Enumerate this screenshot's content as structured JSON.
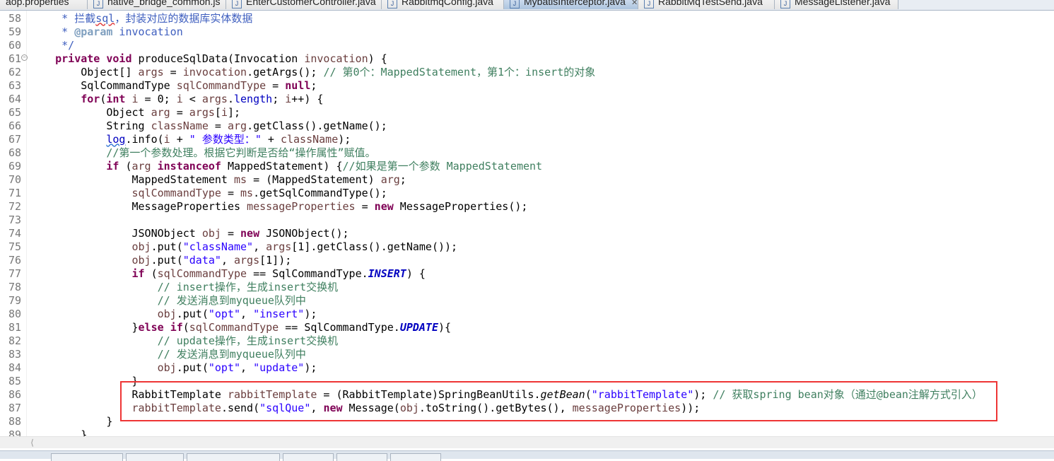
{
  "tabs": [
    {
      "label": "aop.properties",
      "icon": "properties-file-icon",
      "active": false
    },
    {
      "label": "native_bridge_common.js",
      "icon": "js-file-icon",
      "active": false
    },
    {
      "label": "EnterCustomerController.java",
      "icon": "java-file-icon",
      "active": false
    },
    {
      "label": "RabbitmqConfig.java",
      "icon": "java-warning-file-icon",
      "active": false
    },
    {
      "label": "MybatisInterceptor.java",
      "icon": "java-file-icon",
      "active": true
    },
    {
      "label": "RabbitMqTestSend.java",
      "icon": "java-file-icon",
      "active": false
    },
    {
      "label": "MessageListener.java",
      "icon": "java-warning-file-icon",
      "active": false
    }
  ],
  "colors": {
    "keyword": "#7F0055",
    "string": "#2A00FF",
    "comment": "#3F7F5F",
    "javadoc": "#3F5FBF",
    "field": "#0000C0",
    "local": "#6A3E3E",
    "highlight_box": "#EE3535"
  },
  "editor": {
    "lines": [
      {
        "n": "58",
        "t": [
          [
            "j",
            "     * 拦截"
          ],
          [
            "j sp",
            "sql"
          ],
          [
            "j",
            "，封装对应的数据库实体数据"
          ]
        ]
      },
      {
        "n": "59",
        "t": [
          [
            "j",
            "     * "
          ],
          [
            "jt",
            "@param"
          ],
          [
            "j",
            " invocation"
          ]
        ]
      },
      {
        "n": "60",
        "t": [
          [
            "j",
            "     */"
          ]
        ]
      },
      {
        "n": "61",
        "fold": true,
        "t": [
          [
            "p",
            "    "
          ],
          [
            "k",
            "private"
          ],
          [
            "p",
            " "
          ],
          [
            "k",
            "void"
          ],
          [
            "p",
            " produceSqlData(Invocation "
          ],
          [
            "v",
            "invocation"
          ],
          [
            "p",
            ") {"
          ]
        ]
      },
      {
        "n": "62",
        "t": [
          [
            "p",
            "        Object[] "
          ],
          [
            "v",
            "args"
          ],
          [
            "p",
            " = "
          ],
          [
            "v",
            "invocation"
          ],
          [
            "p",
            ".getArgs(); "
          ],
          [
            "c",
            "// 第0个：MappedStatement，第1个：insert的对象"
          ]
        ]
      },
      {
        "n": "63",
        "t": [
          [
            "p",
            "        SqlCommandType "
          ],
          [
            "v",
            "sqlCommandType"
          ],
          [
            "p",
            " = "
          ],
          [
            "k",
            "null"
          ],
          [
            "p",
            ";"
          ]
        ]
      },
      {
        "n": "64",
        "t": [
          [
            "p",
            "        "
          ],
          [
            "k",
            "for"
          ],
          [
            "p",
            "("
          ],
          [
            "k",
            "int"
          ],
          [
            "p",
            " "
          ],
          [
            "v",
            "i"
          ],
          [
            "p",
            " = 0; "
          ],
          [
            "v",
            "i"
          ],
          [
            "p",
            " < "
          ],
          [
            "v",
            "args"
          ],
          [
            "p",
            "."
          ],
          [
            "f",
            "length"
          ],
          [
            "p",
            "; "
          ],
          [
            "v",
            "i"
          ],
          [
            "p",
            "++) {"
          ]
        ]
      },
      {
        "n": "65",
        "t": [
          [
            "p",
            "            Object "
          ],
          [
            "v",
            "arg"
          ],
          [
            "p",
            " = "
          ],
          [
            "v",
            "args"
          ],
          [
            "p",
            "["
          ],
          [
            "v",
            "i"
          ],
          [
            "p",
            "];"
          ]
        ]
      },
      {
        "n": "66",
        "t": [
          [
            "p",
            "            String "
          ],
          [
            "v",
            "className"
          ],
          [
            "p",
            " = "
          ],
          [
            "v",
            "arg"
          ],
          [
            "p",
            ".getClass().getName();"
          ]
        ]
      },
      {
        "n": "67",
        "t": [
          [
            "p",
            "            "
          ],
          [
            "u",
            "log"
          ],
          [
            "p",
            ".info("
          ],
          [
            "v",
            "i"
          ],
          [
            "p",
            " + "
          ],
          [
            "s",
            "\" 参数类型：\""
          ],
          [
            "p",
            " + "
          ],
          [
            "v",
            "className"
          ],
          [
            "p",
            ");"
          ]
        ]
      },
      {
        "n": "68",
        "t": [
          [
            "p",
            "            "
          ],
          [
            "c",
            "//第一个参数处理。根据它判断是否给“操作属性”赋值。"
          ]
        ]
      },
      {
        "n": "69",
        "t": [
          [
            "p",
            "            "
          ],
          [
            "k",
            "if"
          ],
          [
            "p",
            " ("
          ],
          [
            "v",
            "arg"
          ],
          [
            "p",
            " "
          ],
          [
            "k",
            "instanceof"
          ],
          [
            "p",
            " MappedStatement) {"
          ],
          [
            "c",
            "//如果是第一个参数 MappedStatement"
          ]
        ]
      },
      {
        "n": "70",
        "t": [
          [
            "p",
            "                MappedStatement "
          ],
          [
            "v",
            "ms"
          ],
          [
            "p",
            " = (MappedStatement) "
          ],
          [
            "v",
            "arg"
          ],
          [
            "p",
            ";"
          ]
        ]
      },
      {
        "n": "71",
        "t": [
          [
            "p",
            "                "
          ],
          [
            "v",
            "sqlCommandType"
          ],
          [
            "p",
            " = "
          ],
          [
            "v",
            "ms"
          ],
          [
            "p",
            ".getSqlCommandType();"
          ]
        ]
      },
      {
        "n": "72",
        "t": [
          [
            "p",
            "                MessageProperties "
          ],
          [
            "v",
            "messageProperties"
          ],
          [
            "p",
            " = "
          ],
          [
            "k",
            "new"
          ],
          [
            "p",
            " MessageProperties();"
          ]
        ]
      },
      {
        "n": "73",
        "t": []
      },
      {
        "n": "74",
        "t": [
          [
            "p",
            "                JSONObject "
          ],
          [
            "v",
            "obj"
          ],
          [
            "p",
            " = "
          ],
          [
            "k",
            "new"
          ],
          [
            "p",
            " JSONObject();"
          ]
        ]
      },
      {
        "n": "75",
        "t": [
          [
            "p",
            "                "
          ],
          [
            "v",
            "obj"
          ],
          [
            "p",
            ".put("
          ],
          [
            "s",
            "\"className\""
          ],
          [
            "p",
            ", "
          ],
          [
            "v",
            "args"
          ],
          [
            "p",
            "[1].getClass().getName());"
          ]
        ]
      },
      {
        "n": "76",
        "t": [
          [
            "p",
            "                "
          ],
          [
            "v",
            "obj"
          ],
          [
            "p",
            ".put("
          ],
          [
            "s",
            "\"data\""
          ],
          [
            "p",
            ", "
          ],
          [
            "v",
            "args"
          ],
          [
            "p",
            "[1]);"
          ]
        ]
      },
      {
        "n": "77",
        "t": [
          [
            "p",
            "                "
          ],
          [
            "k",
            "if"
          ],
          [
            "p",
            " ("
          ],
          [
            "v",
            "sqlCommandType"
          ],
          [
            "p",
            " == SqlCommandType."
          ],
          [
            "fi",
            "INSERT"
          ],
          [
            "p",
            ") {"
          ]
        ]
      },
      {
        "n": "78",
        "t": [
          [
            "p",
            "                    "
          ],
          [
            "c",
            "// insert操作，生成insert交换机"
          ]
        ]
      },
      {
        "n": "79",
        "t": [
          [
            "p",
            "                    "
          ],
          [
            "c",
            "// 发送消息到myqueue队列中"
          ]
        ]
      },
      {
        "n": "80",
        "t": [
          [
            "p",
            "                    "
          ],
          [
            "v",
            "obj"
          ],
          [
            "p",
            ".put("
          ],
          [
            "s",
            "\"opt\""
          ],
          [
            "p",
            ", "
          ],
          [
            "s",
            "\"insert\""
          ],
          [
            "p",
            ");"
          ]
        ]
      },
      {
        "n": "81",
        "t": [
          [
            "p",
            "                }"
          ],
          [
            "k",
            "else"
          ],
          [
            "p",
            " "
          ],
          [
            "k",
            "if"
          ],
          [
            "p",
            "("
          ],
          [
            "v",
            "sqlCommandType"
          ],
          [
            "p",
            " == SqlCommandType."
          ],
          [
            "fi",
            "UPDATE"
          ],
          [
            "p",
            "){"
          ]
        ]
      },
      {
        "n": "82",
        "t": [
          [
            "p",
            "                    "
          ],
          [
            "c",
            "// update操作，生成insert交换机"
          ]
        ]
      },
      {
        "n": "83",
        "t": [
          [
            "p",
            "                    "
          ],
          [
            "c",
            "// 发送消息到myqueue队列中"
          ]
        ]
      },
      {
        "n": "84",
        "t": [
          [
            "p",
            "                    "
          ],
          [
            "v",
            "obj"
          ],
          [
            "p",
            ".put("
          ],
          [
            "s",
            "\"opt\""
          ],
          [
            "p",
            ", "
          ],
          [
            "s",
            "\"update\""
          ],
          [
            "p",
            ");"
          ]
        ]
      },
      {
        "n": "85",
        "t": [
          [
            "p",
            "                }"
          ]
        ]
      },
      {
        "n": "86",
        "t": [
          [
            "p",
            "                RabbitTemplate "
          ],
          [
            "v",
            "rabbitTemplate"
          ],
          [
            "p",
            " = (RabbitTemplate)SpringBeanUtils."
          ],
          [
            "i",
            "getBean"
          ],
          [
            "p",
            "("
          ],
          [
            "s",
            "\"rabbitTemplate\""
          ],
          [
            "p",
            "); "
          ],
          [
            "c",
            "// 获取spring bean对象（通过@bean注解方式引入）"
          ]
        ]
      },
      {
        "n": "87",
        "t": [
          [
            "p",
            "                "
          ],
          [
            "v",
            "rabbitTemplate"
          ],
          [
            "p",
            ".send("
          ],
          [
            "s",
            "\"sqlQue\""
          ],
          [
            "p",
            ", "
          ],
          [
            "k",
            "new"
          ],
          [
            "p",
            " Message("
          ],
          [
            "v",
            "obj"
          ],
          [
            "p",
            ".toString().getBytes(), "
          ],
          [
            "v",
            "messageProperties"
          ],
          [
            "p",
            "));"
          ]
        ]
      },
      {
        "n": "88",
        "t": [
          [
            "p",
            "            }"
          ]
        ]
      },
      {
        "n": "89",
        "t": [
          [
            "p",
            "        }"
          ]
        ]
      }
    ]
  }
}
